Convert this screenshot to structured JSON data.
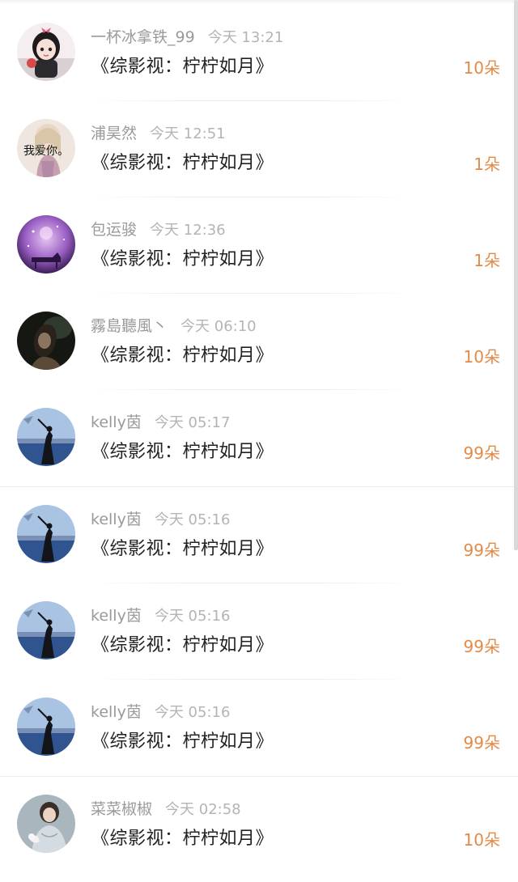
{
  "gifts": [
    {
      "username": "一杯冰拿铁_99",
      "time": "今天 13:21",
      "title": "《综影视：柠柠如月》",
      "amount": "10朵",
      "avatar_icon": "girl-cartoon-avatar-icon",
      "avatar_colors": [
        "#f3e9ec",
        "#2a2224"
      ]
    },
    {
      "username": "浦昊然",
      "time": "今天 12:51",
      "title": "《综影视：柠柠如月》",
      "amount": "1朵",
      "avatar_icon": "woman-photo-avatar-icon",
      "avatar_text": "我爱你。",
      "avatar_colors": [
        "#ece3da",
        "#b58a86"
      ]
    },
    {
      "username": "包运骏",
      "time": "今天 12:36",
      "title": "《综影视：柠柠如月》",
      "amount": "1朵",
      "avatar_icon": "purple-piano-avatar-icon",
      "avatar_colors": [
        "#a873c9",
        "#3a1f52"
      ]
    },
    {
      "username": "霧島聽風丶",
      "time": "今天 06:10",
      "title": "《综影视：柠柠如月》",
      "amount": "10朵",
      "avatar_icon": "dark-portrait-avatar-icon",
      "avatar_colors": [
        "#2d3a2e",
        "#0e0f0c"
      ]
    },
    {
      "username": "kelly茵",
      "time": "今天 05:17",
      "title": "《综影视：柠柠如月》",
      "amount": "99朵",
      "avatar_icon": "blue-lake-avatar-icon",
      "avatar_colors": [
        "#8fb1d8",
        "#25457a"
      ]
    },
    {
      "username": "kelly茵",
      "time": "今天 05:16",
      "title": "《综影视：柠柠如月》",
      "amount": "99朵",
      "avatar_icon": "blue-lake-avatar-icon",
      "avatar_colors": [
        "#8fb1d8",
        "#25457a"
      ]
    },
    {
      "username": "kelly茵",
      "time": "今天 05:16",
      "title": "《综影视：柠柠如月》",
      "amount": "99朵",
      "avatar_icon": "blue-lake-avatar-icon",
      "avatar_colors": [
        "#8fb1d8",
        "#25457a"
      ]
    },
    {
      "username": "kelly茵",
      "time": "今天 05:16",
      "title": "《综影视：柠柠如月》",
      "amount": "99朵",
      "avatar_icon": "blue-lake-avatar-icon",
      "avatar_colors": [
        "#8fb1d8",
        "#25457a"
      ]
    },
    {
      "username": "菜菜椒椒",
      "time": "今天 02:58",
      "title": "《综影视：柠柠如月》",
      "amount": "10朵",
      "avatar_icon": "lady-painting-avatar-icon",
      "avatar_colors": [
        "#b9c3c9",
        "#3d4a55"
      ]
    }
  ],
  "colors": {
    "amount": "#e48a47",
    "username": "#9a9a9a",
    "time": "#b4b4b4",
    "title": "#222222"
  }
}
